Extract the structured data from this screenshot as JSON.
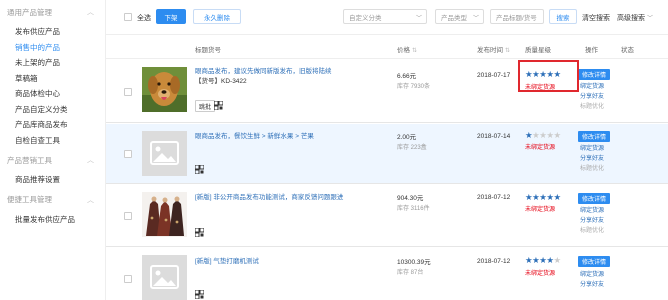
{
  "sidebar": {
    "groups": [
      {
        "label": "通用产品管理",
        "items": [
          "发布供应产品",
          "销售中的产品",
          "未上架的产品",
          "草稿箱",
          "商品体检中心",
          "产品自定义分类",
          "产品库商品发布",
          "自检自查工具"
        ]
      },
      {
        "label": "产品营销工具",
        "items": [
          "商品推荐设置"
        ]
      },
      {
        "label": "便捷工具管理",
        "items": [
          "批量发布供应产品"
        ]
      }
    ],
    "active_item": "销售中的产品"
  },
  "toolbar": {
    "select_all": "全选",
    "btn_offline": "下架",
    "btn_delete": "永久删除",
    "custom_category_placeholder": "自定义分类",
    "product_type_placeholder": "产品类型",
    "search_placeholder": "产品标题/货号",
    "search_button": "搜索",
    "clear_search": "清空搜索",
    "advanced_search": "高级搜索"
  },
  "table": {
    "headers": {
      "title": "标题货号",
      "price": "价格",
      "publish_time": "发布时间",
      "quality": "质量星级",
      "ops": "操作",
      "status": "状态"
    },
    "rows": [
      {
        "title_line1": "眼商品发布，建议先做同新版发布，旧版将陆续",
        "title_line2": "【货号】KD-3422",
        "tag": "跳批",
        "price": "6.66元",
        "stock": "库存 7930条",
        "date": "2018-07-17",
        "stars": 5,
        "unbound": "未绑定货源",
        "op_primary": "修改详情",
        "op_links": [
          "绑定货源",
          "分享好友",
          "标题优化"
        ],
        "has_photo": "dog"
      },
      {
        "title_line1": "眼商品发布，餐饮生鲜 > 新鲜水果 > 芒果",
        "title_line2": "",
        "tag": "",
        "price": "2.00元",
        "stock": "库存 223盒",
        "date": "2018-07-14",
        "stars": 1,
        "unbound": "未绑定货源",
        "op_primary": "修改详情",
        "op_links": [
          "绑定货源",
          "分享好友",
          "标题优化"
        ],
        "has_photo": "placeholder"
      },
      {
        "title_line1": "[新版] 非公开商品发布功能测试，商家反馈问题跟进",
        "title_line2": "",
        "tag": "",
        "price": "904.30元",
        "stock": "库存 3116件",
        "date": "2018-07-12",
        "stars": 5,
        "unbound": "未绑定货源",
        "op_primary": "修改详情",
        "op_links": [
          "绑定货源",
          "分享好友",
          "标题优化"
        ],
        "has_photo": "dresses"
      },
      {
        "title_line1": "[新版] 气垫打磨机测试",
        "title_line2": "",
        "tag": "",
        "price": "10300.39元",
        "stock": "库存 87台",
        "date": "2018-07-12",
        "stars": 4,
        "unbound": "未绑定货源",
        "op_primary": "修改详情",
        "op_links": [
          "绑定货源",
          "分享好友"
        ],
        "has_photo": "placeholder"
      }
    ]
  },
  "colors": {
    "accent": "#2d8cf0",
    "link": "#2d6fb8",
    "warn": "#e60012",
    "highlight_row": "#eef6ff"
  }
}
